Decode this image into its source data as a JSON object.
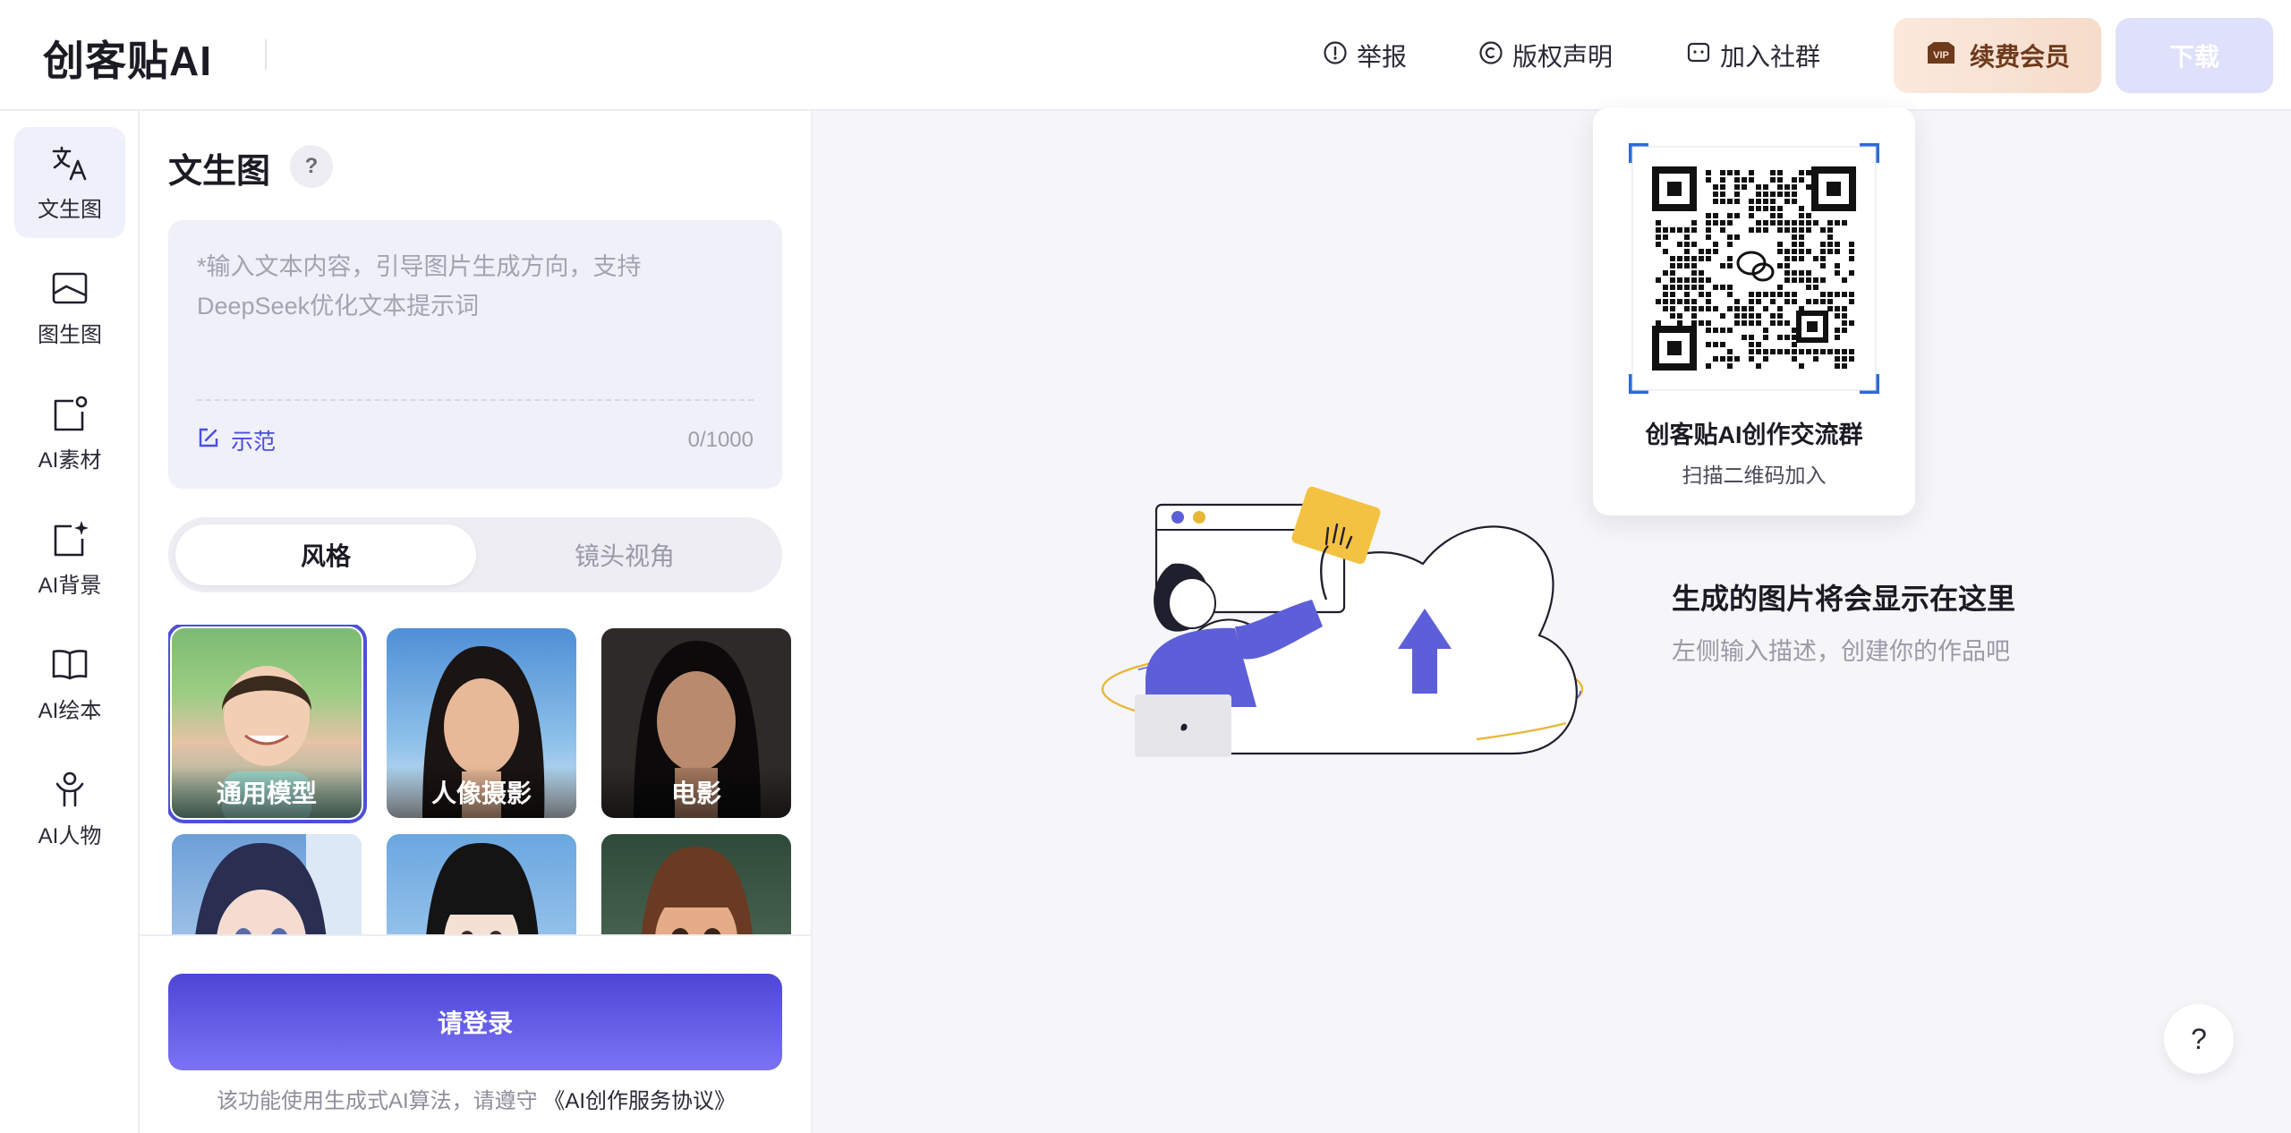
{
  "header": {
    "logo": "创客贴AI",
    "links": [
      {
        "label": "举报",
        "icon": "alert-circle-icon"
      },
      {
        "label": "版权声明",
        "icon": "copyright-icon"
      },
      {
        "label": "加入社群",
        "icon": "chat-icon"
      }
    ],
    "vip_label": "续费会员",
    "download_label": "下载"
  },
  "sidebar": {
    "items": [
      {
        "label": "文生图",
        "icon": "translate-icon",
        "active": true
      },
      {
        "label": "图生图",
        "icon": "image-icon"
      },
      {
        "label": "AI素材",
        "icon": "material-icon"
      },
      {
        "label": "AI背景",
        "icon": "sparkle-frame-icon"
      },
      {
        "label": "AI绘本",
        "icon": "book-icon"
      },
      {
        "label": "AI人物",
        "icon": "person-icon"
      }
    ]
  },
  "panel": {
    "title": "文生图",
    "help": "?",
    "prompt": {
      "placeholder": "*输入文本内容，引导图片生成方向，支持DeepSeek优化文本提示词",
      "demo_label": "示范",
      "count": "0/1000"
    },
    "tabs": {
      "style": "风格",
      "camera": "镜头视角"
    },
    "styles": [
      {
        "label": "通用模型",
        "selected": true
      },
      {
        "label": "人像摄影"
      },
      {
        "label": "电影"
      },
      {
        "label": ""
      },
      {
        "label": ""
      },
      {
        "label": ""
      }
    ],
    "login_label": "请登录",
    "terms_prefix": "该功能使用生成式AI算法，请遵守",
    "terms_link": "《AI创作服务协议》"
  },
  "popup": {
    "title": "创客贴AI创作交流群",
    "subtitle": "扫描二维码加入"
  },
  "empty": {
    "title": "生成的图片将会显示在这里",
    "subtitle": "左侧输入描述，创建你的作品吧"
  },
  "float_help": "?",
  "colors": {
    "accent": "#4e4fd6",
    "vip_text": "#6e3a1c",
    "download_bg": "#dfe0fb"
  }
}
